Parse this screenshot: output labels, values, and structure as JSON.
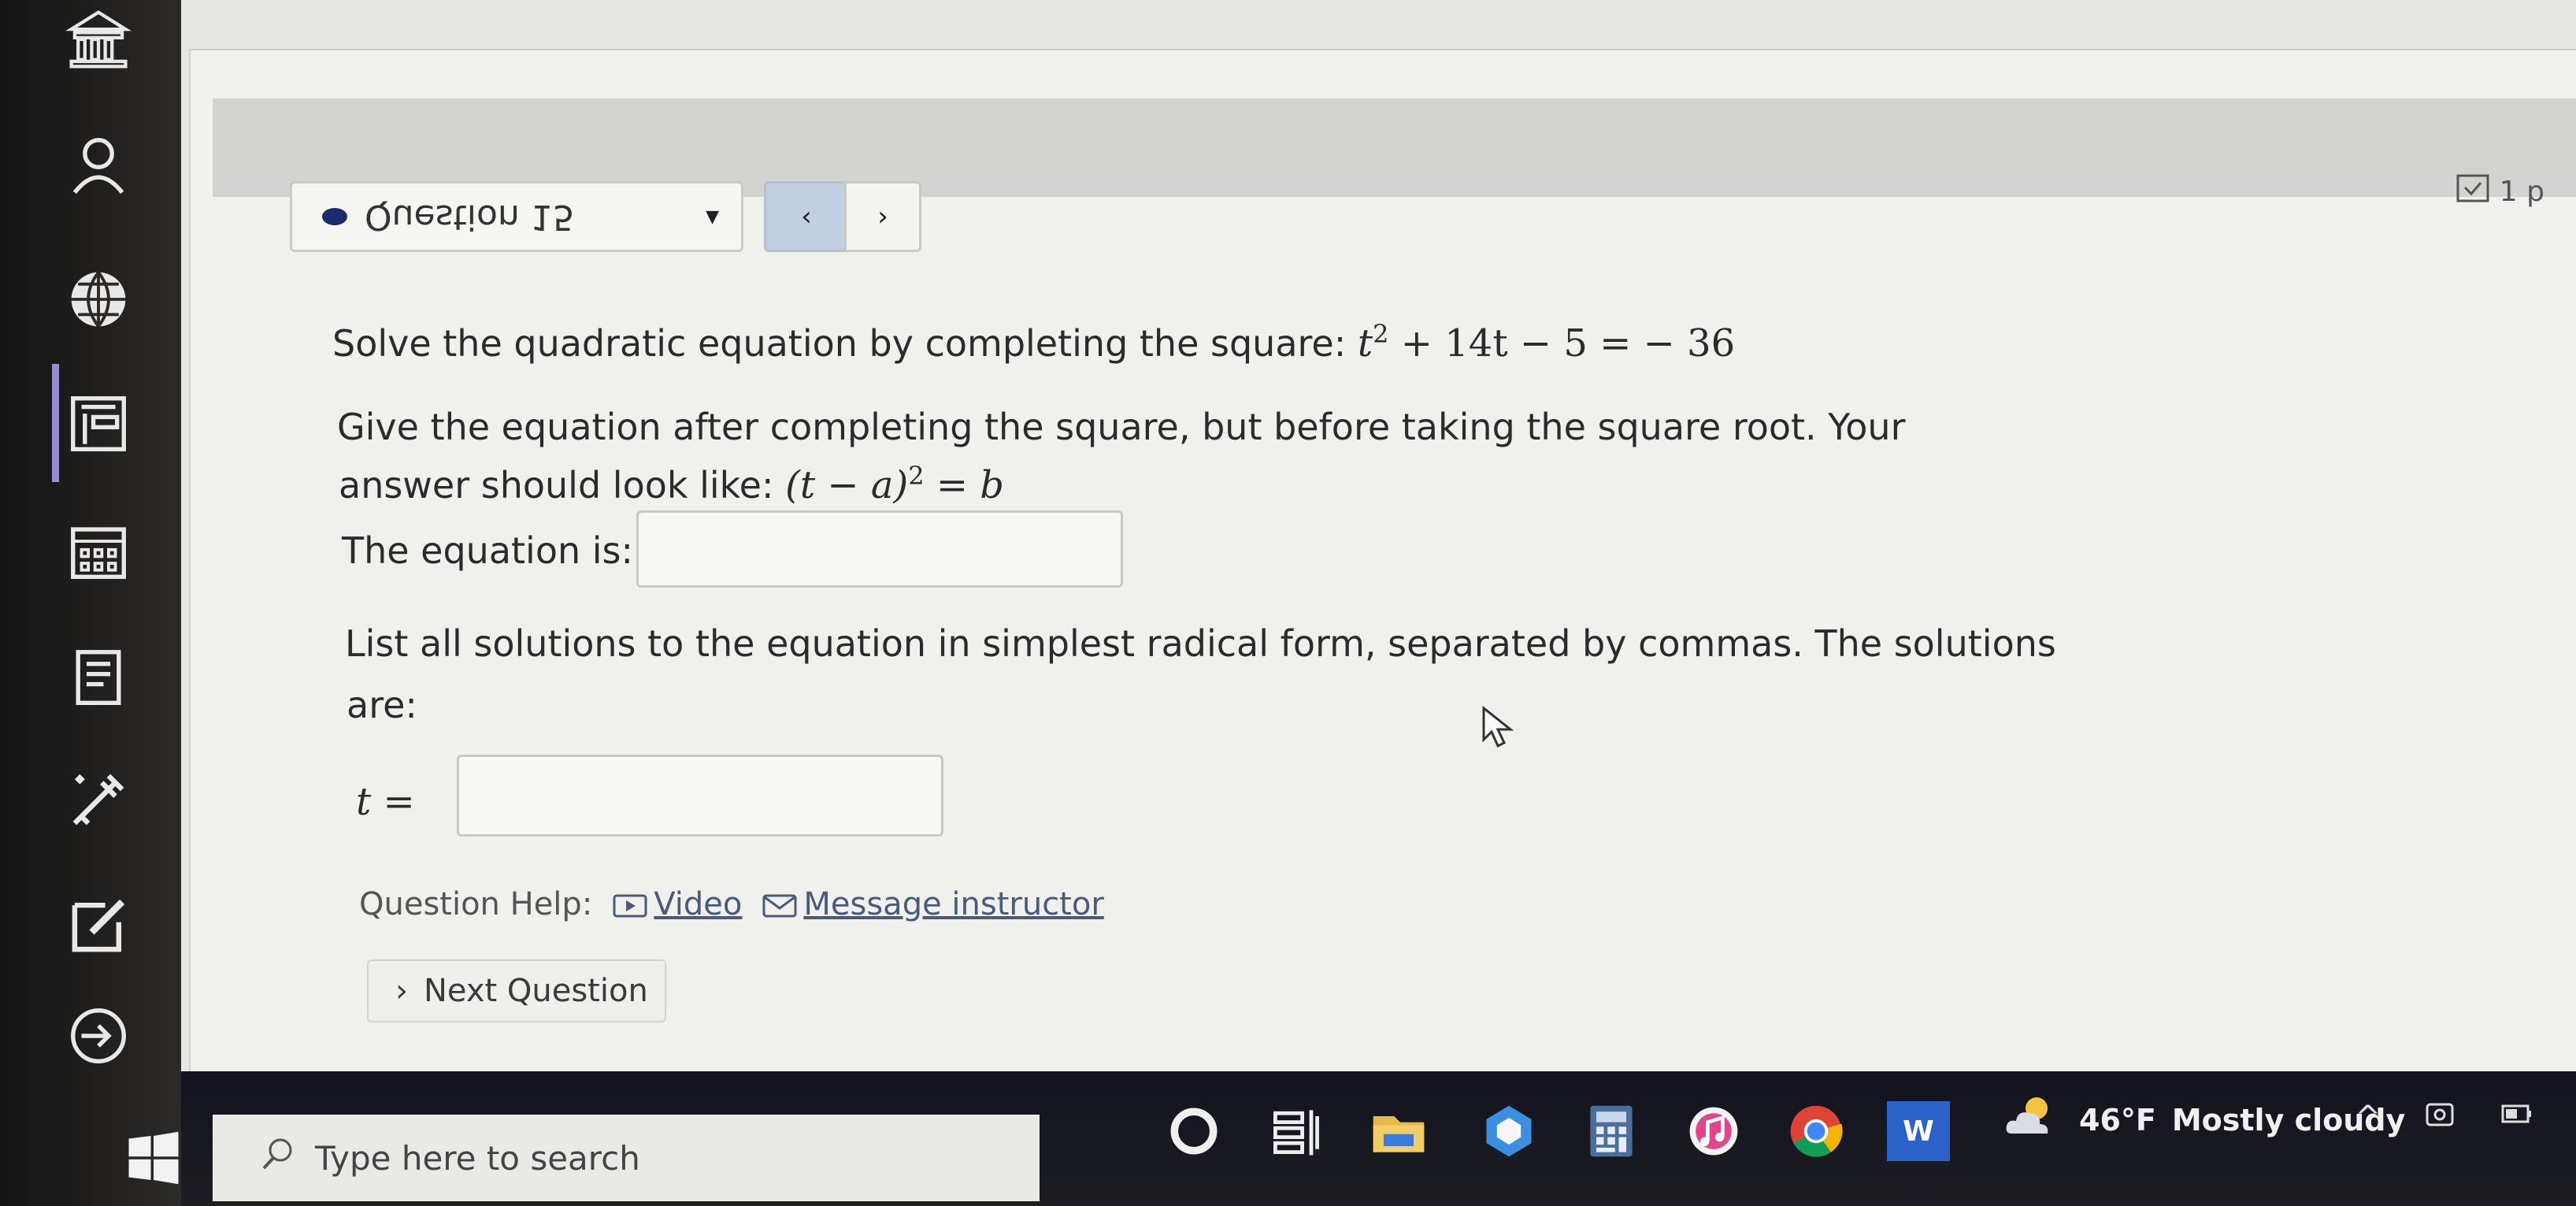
{
  "question_nav": {
    "label": "Question 15",
    "prev_symbol": "‹",
    "next_symbol": "›"
  },
  "corner_text": "1 p",
  "problem": {
    "prompt": "Solve the quadratic equation by completing the square:",
    "equation": {
      "base": "t",
      "exp": "2",
      "rest": " + 14t − 5 = − 36"
    }
  },
  "part1": {
    "line1": "Give the equation after completing the square, but before taking the square root. Your",
    "line2_prefix": "answer should look like:",
    "form": {
      "base": "(t − a)",
      "exp": "2",
      "rest": " = b"
    },
    "label": "The equation is:",
    "answer_value": ""
  },
  "part2": {
    "line1": "List all solutions to the equation in simplest radical form, separated by commas. The solutions",
    "line2": "are:",
    "var_label": "t =",
    "answer_value": ""
  },
  "help": {
    "label": "Question Help:",
    "video": "Video",
    "message": "Message instructor"
  },
  "next_button": {
    "chevron": "›",
    "label": "Next Question"
  },
  "taskbar": {
    "search_placeholder": "Type here to search",
    "word_letter": "W",
    "weather": {
      "temp": "46°F",
      "condition": "Mostly cloudy"
    },
    "tray_chevron": "^"
  },
  "icons": {
    "rail": [
      "institution-icon",
      "user-icon",
      "globe-icon",
      "courses-icon",
      "calendar-icon",
      "inbox-icon",
      "tools-icon",
      "edit-icon",
      "logout-icon"
    ],
    "taskbar": [
      "windows-start-icon",
      "search-icon",
      "cortana-icon",
      "task-view-icon",
      "file-explorer-icon",
      "app-icon",
      "calculator-icon",
      "itunes-icon",
      "chrome-icon",
      "word-icon"
    ]
  },
  "colors": {
    "rail_active": "#9a8bd6",
    "question_dot": "#1a2b6b",
    "link": "#4a5a7a"
  }
}
